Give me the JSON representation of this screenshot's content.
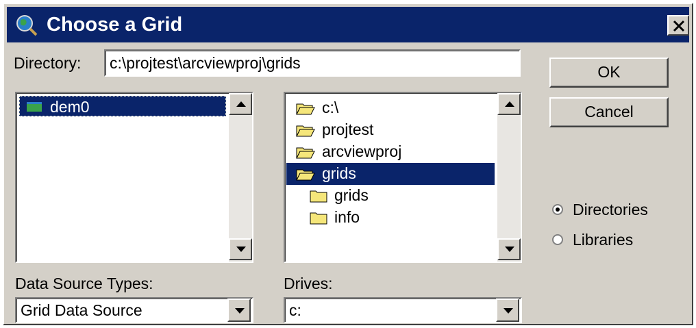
{
  "window": {
    "title": "Choose a Grid",
    "app_icon": "globe-magnifier-icon",
    "close_icon": "close-icon"
  },
  "directory": {
    "label": "Directory:",
    "value": "c:\\projtest\\arcviewproj\\grids"
  },
  "buttons": {
    "ok": "OK",
    "cancel": "Cancel"
  },
  "grid_list": {
    "items": [
      {
        "label": "dem0",
        "icon": "grid-layer-icon",
        "selected": true
      }
    ]
  },
  "dir_tree": {
    "items": [
      {
        "label": "c:\\",
        "icon": "open-folder-icon",
        "level": 0,
        "selected": false
      },
      {
        "label": "projtest",
        "icon": "open-folder-icon",
        "level": 0,
        "selected": false
      },
      {
        "label": "arcviewproj",
        "icon": "open-folder-icon",
        "level": 0,
        "selected": false
      },
      {
        "label": "grids",
        "icon": "open-folder-icon",
        "level": 0,
        "selected": true
      },
      {
        "label": "grids",
        "icon": "closed-folder-icon",
        "level": 1,
        "selected": false
      },
      {
        "label": "info",
        "icon": "closed-folder-icon",
        "level": 1,
        "selected": false
      }
    ]
  },
  "options": {
    "directories": {
      "label": "Directories",
      "checked": true
    },
    "libraries": {
      "label": "Libraries",
      "checked": false
    }
  },
  "data_source_types": {
    "label": "Data Source Types:",
    "value": "Grid Data Source"
  },
  "drives": {
    "label": "Drives:",
    "value": "c:"
  },
  "colors": {
    "title_bar": "#0a246a",
    "face": "#d4d0c8",
    "selection": "#0a246a"
  }
}
